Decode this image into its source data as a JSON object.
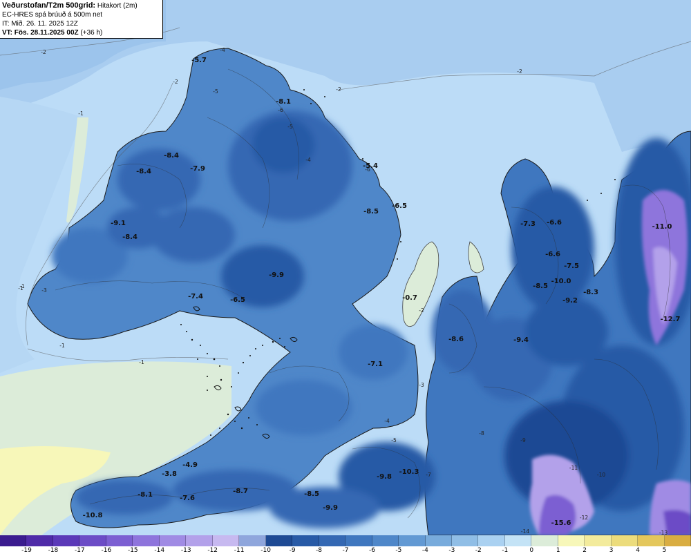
{
  "header": {
    "title": "Veðurstofan/T2m 500grid:",
    "subtitle": "Hitakort (2m)",
    "model_line": "EC-HRES spá brúuð á 500m net",
    "init_time": "IT: Mið. 26. 11. 2025 12Z",
    "valid_time": "VT: Fös. 28.11.2025 00Z",
    "lead_time": "(+36 h)"
  },
  "point_labels": [
    {
      "text": "-5.7"
    },
    {
      "text": "-8.1"
    },
    {
      "text": "-8.4"
    },
    {
      "text": "-7.9"
    },
    {
      "text": "-8.4"
    },
    {
      "text": "-5.4"
    },
    {
      "text": "-8.5"
    },
    {
      "text": "-6.5"
    },
    {
      "text": "-9.1"
    },
    {
      "text": "-8.4"
    },
    {
      "text": "-7.3"
    },
    {
      "text": "-6.6"
    },
    {
      "text": "-6.6"
    },
    {
      "text": "-7.5"
    },
    {
      "text": "-8.5"
    },
    {
      "text": "-10.0"
    },
    {
      "text": "-8.3"
    },
    {
      "text": "-9.2"
    },
    {
      "text": "-11.0"
    },
    {
      "text": "-9.9"
    },
    {
      "text": "-7.4"
    },
    {
      "text": "-6.5"
    },
    {
      "text": "-0.7"
    },
    {
      "text": "-8.6"
    },
    {
      "text": "-9.4"
    },
    {
      "text": "-12.7"
    },
    {
      "text": "-7.1"
    },
    {
      "text": "-9.8"
    },
    {
      "text": "-10.3"
    },
    {
      "text": "-4.9"
    },
    {
      "text": "-3.8"
    },
    {
      "text": "-8.1"
    },
    {
      "text": "-7.6"
    },
    {
      "text": "-8.7"
    },
    {
      "text": "-8.5"
    },
    {
      "text": "-9.9"
    },
    {
      "text": "-10.8"
    },
    {
      "text": "-15.6"
    }
  ],
  "contour_labels": [
    "-2",
    "-2",
    "-2",
    "-2",
    "-1",
    "-1",
    "-1",
    "-1",
    "-2",
    "-1",
    "-3",
    "-4",
    "-5",
    "-6",
    "-5",
    "-4",
    "-6",
    "-8",
    "-9",
    "-11",
    "-10",
    "-12",
    "-13",
    "-14",
    "-4",
    "-3",
    "-5",
    "-7"
  ],
  "legend": {
    "colors": [
      "#3b1c8f",
      "#4f2ba8",
      "#5b39b8",
      "#6c4cc6",
      "#7c5fd2",
      "#8e74dc",
      "#a08be4",
      "#b3a1ea",
      "#c7b9f0",
      "#8fa6dc",
      "#1e4a94",
      "#285aa6",
      "#3468b3",
      "#3f77bf",
      "#4f87c9",
      "#6299d3",
      "#78abdc",
      "#90bee6",
      "#aad1f1",
      "#c4e3f6",
      "#dcecd9",
      "#f7f7b9",
      "#f3eb9c",
      "#ecdc7c",
      "#e4c75c",
      "#d9ad42"
    ],
    "ticks": [
      "-19",
      "-18",
      "-17",
      "-16",
      "-15",
      "-14",
      "-13",
      "-12",
      "-11",
      "-10",
      "-9",
      "-8",
      "-7",
      "-6",
      "-5",
      "-4",
      "-3",
      "-2",
      "-1",
      "0",
      "1",
      "2",
      "3",
      "4",
      "5"
    ]
  }
}
